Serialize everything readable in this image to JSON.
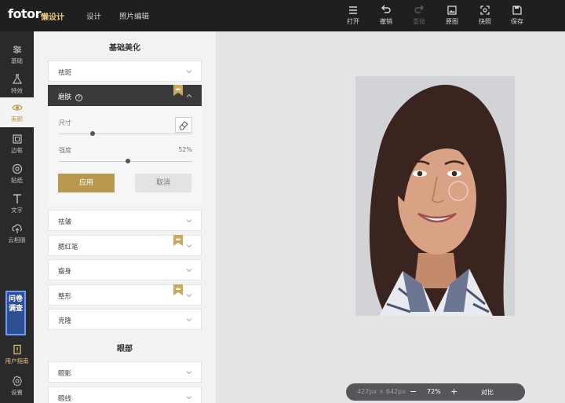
{
  "app": {
    "logo": "fotor",
    "logo_sub": "懒设计",
    "nav": [
      "设计",
      "照片编辑"
    ]
  },
  "toolbar": {
    "open": "打开",
    "undo": "撤销",
    "redo": "重做",
    "layers": "原图",
    "snapshot": "快照",
    "save": "保存"
  },
  "sidebar": {
    "items": [
      {
        "label": "基础",
        "icon": "sliders-icon"
      },
      {
        "label": "特效",
        "icon": "flask-icon"
      },
      {
        "label": "美颜",
        "icon": "eye-icon"
      },
      {
        "label": "边框",
        "icon": "frame-icon"
      },
      {
        "label": "贴纸",
        "icon": "sticker-icon"
      },
      {
        "label": "文字",
        "icon": "text-icon"
      },
      {
        "label": "云相册",
        "icon": "cloud-icon"
      },
      {
        "label": "用户指南",
        "icon": "guide-icon"
      },
      {
        "label": "设置",
        "icon": "gear-icon"
      }
    ],
    "survey": "问卷调查",
    "active_color": "#b99845"
  },
  "panel": {
    "section1": "基础美化",
    "blemish": "祛斑",
    "smooth": "磨肤",
    "size_label": "尺寸",
    "intensity_label": "强度",
    "intensity_value": "52%",
    "size_level": 0.25,
    "intensity_level": 0.52,
    "apply": "应用",
    "cancel": "取消",
    "wrinkle": "祛皱",
    "blush": "腮红笔",
    "slim": "瘦身",
    "reshape": "整形",
    "clone": "克隆",
    "section2": "眼部",
    "eyeshadow": "眼影",
    "eye_partial": "眼线"
  },
  "canvas": {
    "dimensions": "427px × 642px",
    "zoom": "72%",
    "compare": "对比",
    "minus": "−",
    "plus": "+"
  }
}
